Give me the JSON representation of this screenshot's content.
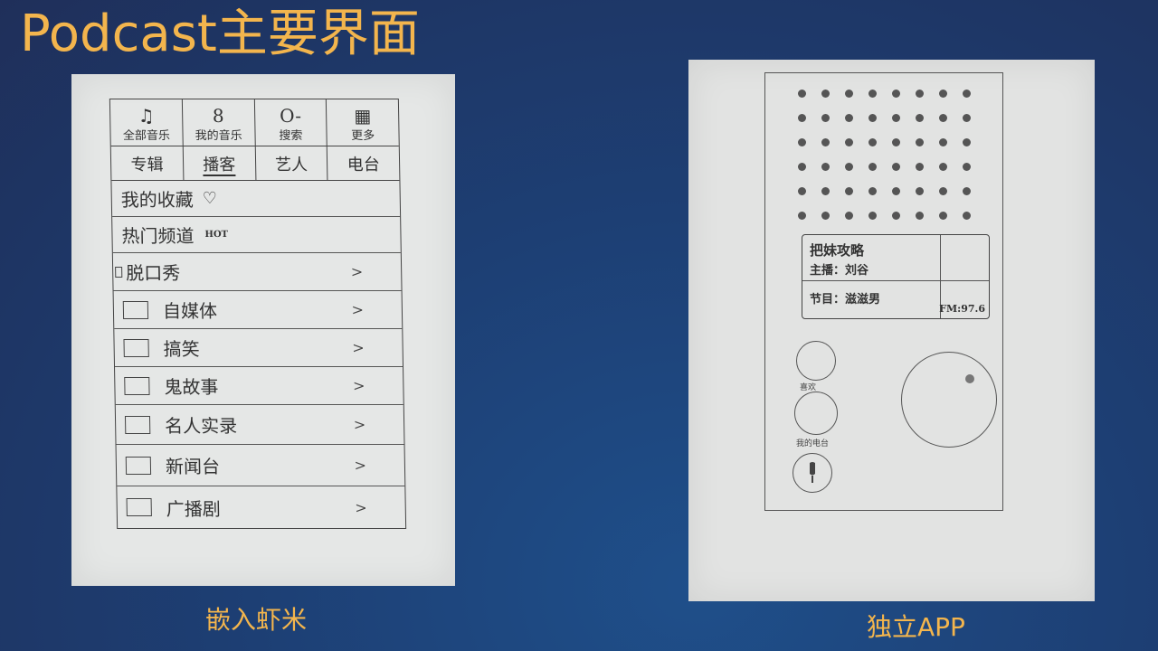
{
  "slide": {
    "title": "Podcast主要界面",
    "left_caption": "嵌入虾米",
    "right_caption": "独立APP"
  },
  "xiami_sketch": {
    "top_items": [
      {
        "icon": "music-note-icon",
        "glyph": "♫",
        "label": "全部音乐"
      },
      {
        "icon": "user-icon",
        "glyph": "8",
        "label": "我的音乐"
      },
      {
        "icon": "search-icon",
        "glyph": "O-",
        "label": "搜索"
      },
      {
        "icon": "grid-icon",
        "glyph": "▦",
        "label": "更多"
      }
    ],
    "tabs": [
      "专辑",
      "播客",
      "艺人",
      "电台"
    ],
    "active_tab": "播客",
    "favorites": {
      "label": "我的收藏",
      "icon": "heart-icon",
      "glyph": "♡"
    },
    "hot": {
      "label": "热门频道",
      "badge": "HOT"
    },
    "categories": [
      {
        "label": "脱口秀",
        "chevron": ">"
      },
      {
        "label": "自媒体",
        "chevron": ">"
      },
      {
        "label": "搞笑",
        "chevron": ">"
      },
      {
        "label": "鬼故事",
        "chevron": ">"
      },
      {
        "label": "名人实录",
        "chevron": ">"
      },
      {
        "label": "新闻台",
        "chevron": ">"
      },
      {
        "label": "广播剧",
        "chevron": ">"
      }
    ]
  },
  "app_sketch": {
    "card": {
      "title": "把妹攻略",
      "host": "主播：刘谷",
      "program": "节目：滋滋男",
      "frequency": "FM:97.6"
    },
    "buttons": {
      "small_top_label": "喜欢",
      "small_bottom_label": "我的电台",
      "mic_icon": "microphone-icon"
    }
  }
}
